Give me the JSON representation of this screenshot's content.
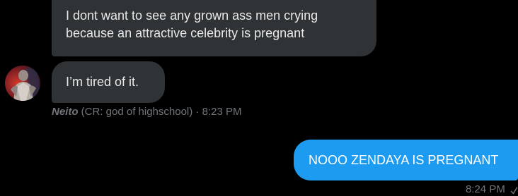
{
  "conversation": {
    "incoming": {
      "messages": [
        {
          "text": "I dont want to see any grown ass men crying because an attractive celebrity is pregnant"
        },
        {
          "text": "I’m tired of it."
        }
      ],
      "sender": {
        "name": "Neito",
        "tag": "(CR: god of highschool)",
        "separator": "·",
        "time": "8:23 PM"
      }
    },
    "outgoing": {
      "messages": [
        {
          "text": "NOOO ZENDAYA IS PREGNANT"
        }
      ],
      "time": "8:24 PM",
      "status_icon": "checkmark-icon"
    }
  },
  "colors": {
    "background": "#000000",
    "incoming_bubble": "#2f3336",
    "outgoing_bubble": "#1d9bf0",
    "meta_text": "#71767b"
  }
}
